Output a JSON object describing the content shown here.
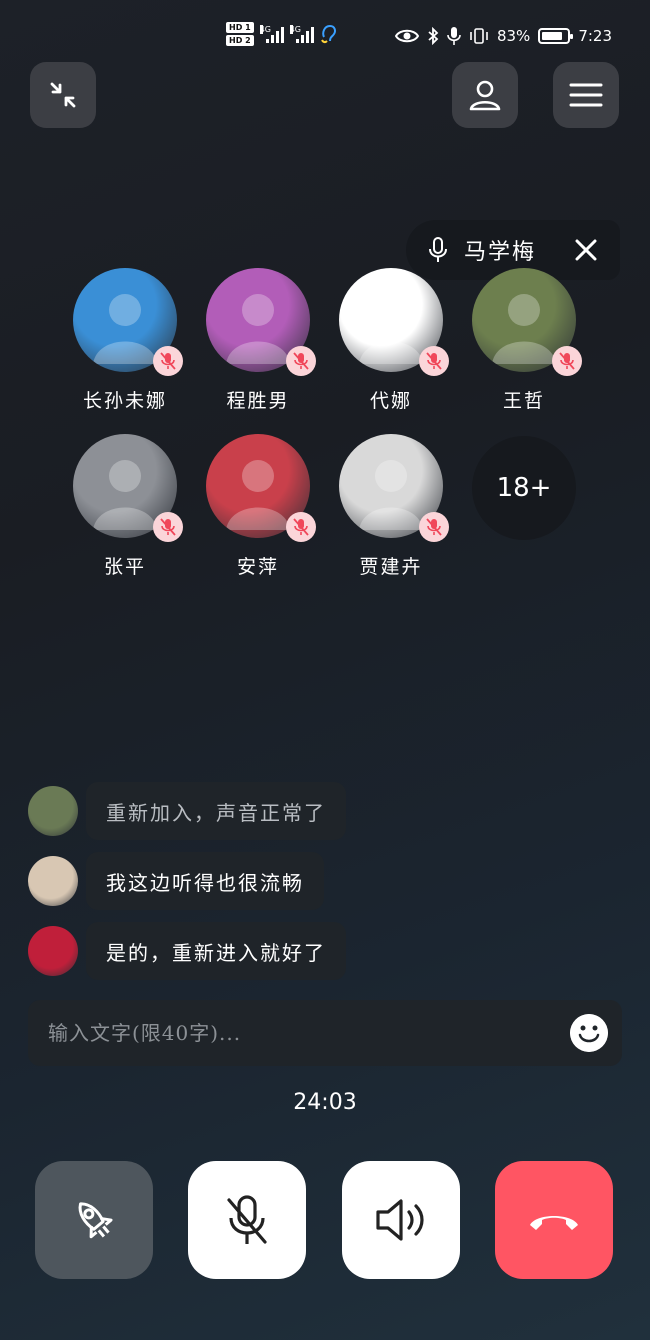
{
  "status_bar": {
    "hd1": "HD 1",
    "hd2": "HD 2",
    "net1": "4G",
    "net2": "4G",
    "battery_percent": "83%",
    "battery_level": 0.83,
    "time": "7:23"
  },
  "speaking": {
    "name": "马学梅"
  },
  "participants": [
    {
      "name": "长孙未娜",
      "muted": true,
      "avatar_color": "#3a8fd6"
    },
    {
      "name": "程胜男",
      "muted": true,
      "avatar_color": "#b25db8"
    },
    {
      "name": "代娜",
      "muted": true,
      "avatar_color": "#ffffff"
    },
    {
      "name": "王哲",
      "muted": true,
      "avatar_color": "#6d7f4e"
    },
    {
      "name": "张平",
      "muted": true,
      "avatar_color": "#8d9096"
    },
    {
      "name": "安萍",
      "muted": true,
      "avatar_color": "#c9404b"
    },
    {
      "name": "贾建卉",
      "muted": true,
      "avatar_color": "#d9d9d9"
    }
  ],
  "more_count": "18+",
  "chat": [
    {
      "text": "重新加入，声音正常了",
      "avatar_color": "#6a7a55",
      "muted_text": true
    },
    {
      "text": "我这边听得也很流畅",
      "avatar_color": "#d8c7b3",
      "muted_text": false
    },
    {
      "text": "是的，重新进入就好了",
      "avatar_color": "#c01f3a",
      "muted_text": false
    }
  ],
  "input": {
    "placeholder": "输入文字(限40字)..."
  },
  "timer": "24:03",
  "colors": {
    "hangup": "#ff5563",
    "mute_badge": "#fbd5d9",
    "mute_icon": "#f0475a"
  }
}
